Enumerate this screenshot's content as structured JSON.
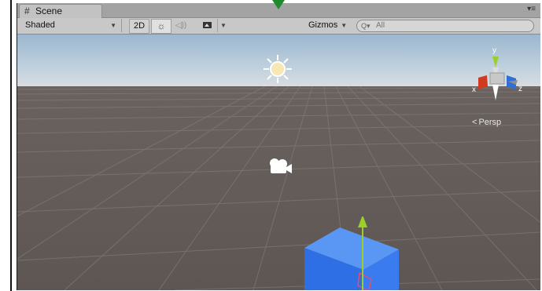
{
  "panel": {
    "tab_title": "Scene",
    "tab_icon": "grid-hash-icon",
    "menu_icon": "panel-menu-icon"
  },
  "toolbar": {
    "draw_mode": "Shaded",
    "btn_2d": "2D",
    "lighting_icon": "sun-toggle-icon",
    "audio_icon": "speaker-icon",
    "effects_icon": "image-effects-icon",
    "gizmos_label": "Gizmos",
    "search_placeholder": "All",
    "search_prefix": "Q▾"
  },
  "viewport": {
    "persp_label": "Persp",
    "axis_x": "x",
    "axis_y": "y",
    "axis_z": "z"
  },
  "colors": {
    "sky_top": "#9cb7cf",
    "ground": "#6a625f",
    "axis_x": "#d23a1f",
    "axis_y": "#9bd02a",
    "axis_z": "#2f6fd6",
    "cube": "#3a7cf0",
    "marker": "#1f8b2c"
  }
}
